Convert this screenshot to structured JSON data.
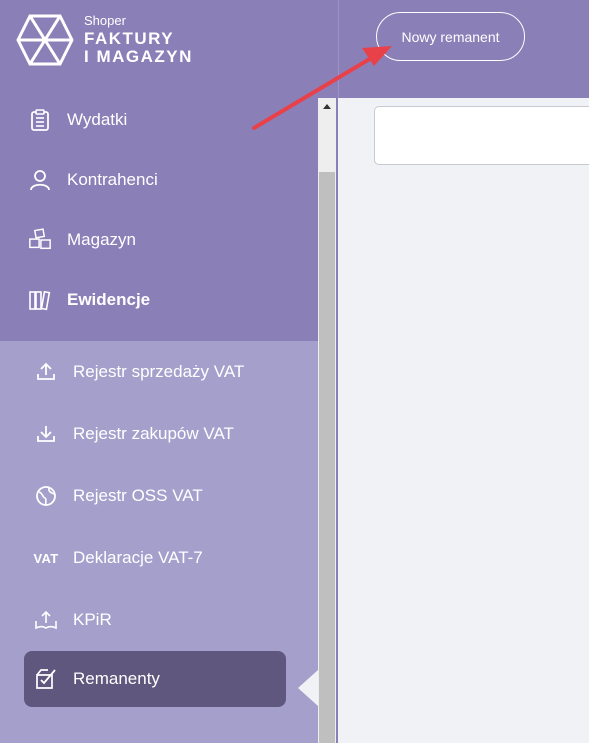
{
  "logo": {
    "brand": "Shoper",
    "line1": "FAKTURY",
    "line2": "I MAGAZYN"
  },
  "nav": {
    "items": [
      {
        "label": "Wydatki",
        "icon": "clipboard-icon"
      },
      {
        "label": "Kontrahenci",
        "icon": "user-icon"
      },
      {
        "label": "Magazyn",
        "icon": "boxes-icon"
      },
      {
        "label": "Ewidencje",
        "icon": "books-icon"
      }
    ]
  },
  "subnav": {
    "items": [
      {
        "label": "Rejestr sprzedaży VAT",
        "icon": "upload-icon"
      },
      {
        "label": "Rejestr zakupów VAT",
        "icon": "download-icon"
      },
      {
        "label": "Rejestr OSS VAT",
        "icon": "globe-icon"
      },
      {
        "label": "Deklaracje VAT-7",
        "icon": "vat-icon",
        "icon_text": "VAT"
      },
      {
        "label": "KPiR",
        "icon": "book-upload-icon"
      },
      {
        "label": "Remanenty",
        "icon": "checkbox-box-icon",
        "active": true
      }
    ]
  },
  "header": {
    "new_button": "Nowy remanent"
  },
  "colors": {
    "sidebar": "#8b7fb8",
    "subnav": "#a59fcc",
    "active": "#5f577d",
    "annotation_arrow": "#e8414a"
  }
}
